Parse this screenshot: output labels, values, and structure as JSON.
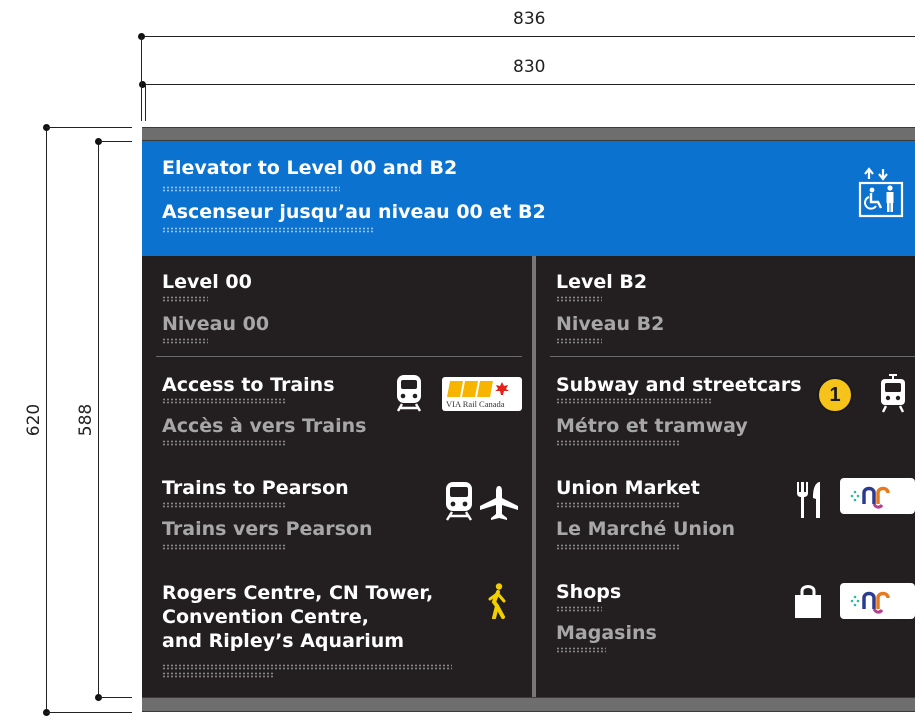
{
  "dimensions": {
    "width_outer": "836",
    "width_inner": "830",
    "height_outer": "620",
    "height_inner": "588"
  },
  "header": {
    "title_en": "Elevator to Level 00 and B2",
    "title_fr": "Ascenseur jusqu’au niveau 00 et B2",
    "icon": "elevator-accessible-icon"
  },
  "left": {
    "level_en": "Level 00",
    "level_fr": "Niveau 00",
    "items": [
      {
        "en": "Access to Trains",
        "fr": "Accès à vers Trains",
        "icons": [
          "train-icon",
          "via-rail-logo"
        ]
      },
      {
        "en": "Trains to Pearson",
        "fr": "Trains vers Pearson",
        "icons": [
          "train-icon",
          "airplane-icon"
        ]
      },
      {
        "en_lines": [
          "Rogers Centre, CN Tower,",
          "Convention Centre,",
          "and Ripley’s Aquarium"
        ],
        "icons": [
          "pedestrian-icon"
        ]
      }
    ],
    "via_rail": {
      "logo_text": "VIA",
      "caption": "VIA Rail Canada"
    }
  },
  "right": {
    "level_en": "Level B2",
    "level_fr": "Niveau B2",
    "items": [
      {
        "en": "Subway and streetcars",
        "fr": "Métro et tramway",
        "badge": "1",
        "icons": [
          "streetcar-icon"
        ]
      },
      {
        "en": "Union Market",
        "fr": "Le Marché Union",
        "icons": [
          "fork-knife-icon",
          "union-logo"
        ]
      },
      {
        "en": "Shops",
        "fr": "Magasins",
        "icons": [
          "shopping-bag-icon",
          "union-logo"
        ]
      }
    ]
  },
  "colors": {
    "header_blue": "#0b72cf",
    "sign_dark": "#231f20",
    "frame_grey": "#6e6e6e",
    "text_grey": "#a7a7a7",
    "ttc_yellow": "#f6c31a",
    "pedestrian_yellow": "#f2d000",
    "via_red": "#e2231a",
    "via_yellow": "#f7b500"
  }
}
